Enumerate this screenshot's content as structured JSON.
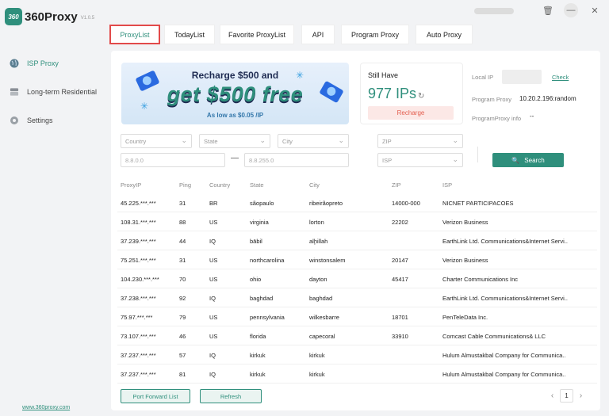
{
  "app": {
    "logo_mark": "360",
    "name": "360Proxy",
    "version": "V1.0.5",
    "footer_link": "www.360proxy.com"
  },
  "sidebar": {
    "items": [
      {
        "label": "ISP Proxy",
        "icon": "globe-icon",
        "active": true
      },
      {
        "label": "Long-term Residential",
        "icon": "house-icon",
        "active": false
      },
      {
        "label": "Settings",
        "icon": "gear-icon",
        "active": false
      }
    ]
  },
  "window": {
    "icons": [
      "trash-icon",
      "minimize-icon",
      "close-icon"
    ],
    "trash_glyph": "🗑",
    "minimize_glyph": "—",
    "close_glyph": "✕"
  },
  "tabs": [
    {
      "label": "ProxyList",
      "active": true
    },
    {
      "label": "TodayList",
      "active": false
    },
    {
      "label": "Favorite ProxyList",
      "active": false
    },
    {
      "label": "API",
      "active": false
    },
    {
      "label": "Program Proxy",
      "active": false
    },
    {
      "label": "Auto Proxy",
      "active": false
    }
  ],
  "banner": {
    "line1": "Recharge $500 and",
    "line2": "get $500 free",
    "line3": "As low as $0.05 /IP"
  },
  "balance": {
    "title": "Still Have",
    "amount": "977 IPs",
    "refresh_glyph": "↻",
    "recharge_label": "Recharge"
  },
  "info": {
    "local_ip_label": "Local IP",
    "check_label": "Check",
    "program_proxy_label": "Program Proxy",
    "program_proxy_value": "10.20.2.196:random",
    "program_proxy_info_label": "ProgramProxy info",
    "program_proxy_info_value": "--"
  },
  "filters": {
    "country": "Country",
    "state": "State",
    "city": "City",
    "zip": "ZIP",
    "isp": "ISP",
    "ip_from_placeholder": "8.8.0.0",
    "ip_to_placeholder": "8.8.255.0",
    "range_separator": "—",
    "chevron": "⌄",
    "search_label": "Search",
    "search_glyph": "🔍"
  },
  "table": {
    "columns": [
      "ProxyIP",
      "Ping",
      "Country",
      "State",
      "City",
      "ZIP",
      "ISP"
    ],
    "rows": [
      [
        "45.225.***.***",
        "31",
        "BR",
        "sãopaulo",
        "ribeirãopreto",
        "14000-000",
        "NICNET PARTICIPACOES"
      ],
      [
        "108.31.***.***",
        "88",
        "US",
        "virginia",
        "lorton",
        "22202",
        "Verizon Business"
      ],
      [
        "37.239.***.***",
        "44",
        "IQ",
        "bābil",
        "alḩillah",
        "",
        "EarthLink Ltd. Communications&Internet Servi.."
      ],
      [
        "75.251.***.***",
        "31",
        "US",
        "northcarolina",
        "winstonsalem",
        "20147",
        "Verizon Business"
      ],
      [
        "104.230.***.***",
        "70",
        "US",
        "ohio",
        "dayton",
        "45417",
        "Charter Communications Inc"
      ],
      [
        "37.238.***.***",
        "92",
        "IQ",
        "baghdad",
        "baghdad",
        "",
        "EarthLink Ltd. Communications&Internet Servi.."
      ],
      [
        "75.97.***.***",
        "79",
        "US",
        "pennsylvania",
        "wilkesbarre",
        "18701",
        "PenTeleData Inc."
      ],
      [
        "73.107.***.***",
        "46",
        "US",
        "florida",
        "capecoral",
        "33910",
        "Comcast Cable Communications& LLC"
      ],
      [
        "37.237.***.***",
        "57",
        "IQ",
        "kirkuk",
        "kirkuk",
        "",
        "Hulum Almustakbal Company for Communica.."
      ],
      [
        "37.237.***.***",
        "81",
        "IQ",
        "kirkuk",
        "kirkuk",
        "",
        "Hulum Almustakbal Company for Communica.."
      ]
    ]
  },
  "bottom": {
    "port_forward_label": "Port Forward List",
    "refresh_label": "Refresh",
    "page": "1",
    "prev_glyph": "‹",
    "next_glyph": "›"
  },
  "colors": {
    "accent": "#2f8f7c",
    "active_tab_border": "#e24a4a",
    "recharge_text": "#e35d4e"
  }
}
